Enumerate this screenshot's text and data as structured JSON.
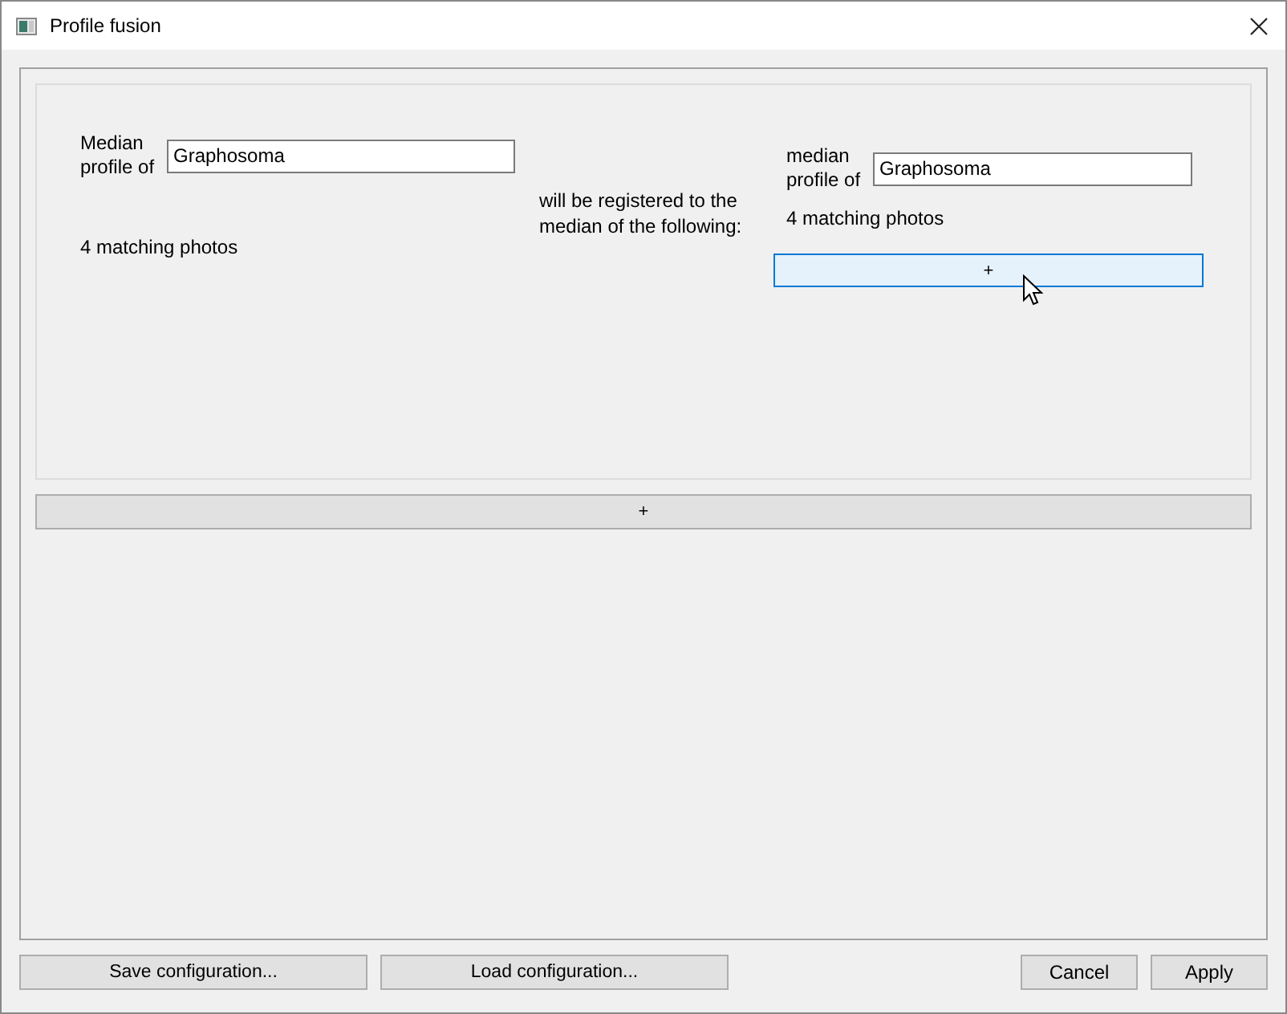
{
  "window": {
    "title": "Profile fusion"
  },
  "source": {
    "label": "Median\nprofile of",
    "value": "Graphosoma",
    "count": "4 matching photos"
  },
  "relation": "will be registered to the\nmedian of the following:",
  "targets": [
    {
      "label": "median\nprofile of",
      "value": "Graphosoma",
      "count": "4 matching photos"
    }
  ],
  "target_add_button": {
    "label": "+",
    "focused": true
  },
  "add_button": {
    "label": "+"
  },
  "footer_left": [
    "Save configuration...",
    "Load configuration..."
  ],
  "footer_right": [
    "Cancel",
    "Apply"
  ]
}
